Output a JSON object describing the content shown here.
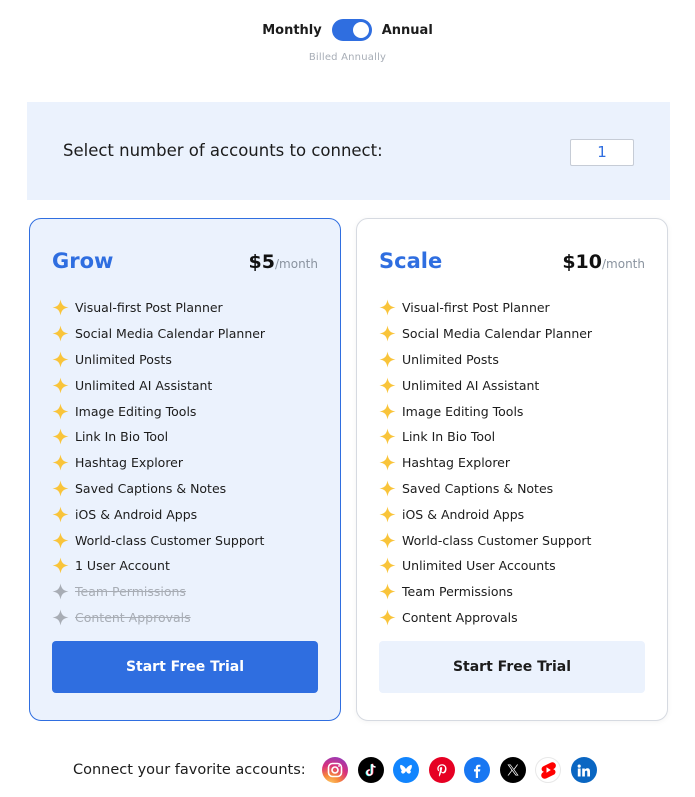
{
  "billing": {
    "monthly_label": "Monthly",
    "annual_label": "Annual",
    "toggle_state": "annual",
    "note": "Billed Annually"
  },
  "accounts": {
    "prompt": "Select number of accounts to connect:",
    "count": "1"
  },
  "colors": {
    "accent": "#2f6ee0",
    "panel": "#ebf2fd",
    "star": "#f9c43a",
    "star_disabled": "#a8adb5"
  },
  "plans": [
    {
      "name": "Grow",
      "price": "$5",
      "period": "/month",
      "cta": "Start Free Trial",
      "features": [
        {
          "text": "Visual-first Post Planner",
          "included": true
        },
        {
          "text": "Social Media Calendar Planner",
          "included": true
        },
        {
          "text": "Unlimited Posts",
          "included": true
        },
        {
          "text": "Unlimited AI Assistant",
          "included": true
        },
        {
          "text": "Image Editing Tools",
          "included": true
        },
        {
          "text": "Link In Bio Tool",
          "included": true
        },
        {
          "text": "Hashtag Explorer",
          "included": true
        },
        {
          "text": "Saved Captions & Notes",
          "included": true
        },
        {
          "text": "iOS & Android Apps",
          "included": true
        },
        {
          "text": "World-class Customer Support",
          "included": true
        },
        {
          "text": "1 User Account",
          "included": true
        },
        {
          "text": "Team Permissions",
          "included": false
        },
        {
          "text": "Content Approvals",
          "included": false
        }
      ]
    },
    {
      "name": "Scale",
      "price": "$10",
      "period": "/month",
      "cta": "Start Free Trial",
      "features": [
        {
          "text": "Visual-first Post Planner",
          "included": true
        },
        {
          "text": "Social Media Calendar Planner",
          "included": true
        },
        {
          "text": "Unlimited Posts",
          "included": true
        },
        {
          "text": "Unlimited AI Assistant",
          "included": true
        },
        {
          "text": "Image Editing Tools",
          "included": true
        },
        {
          "text": "Link In Bio Tool",
          "included": true
        },
        {
          "text": "Hashtag Explorer",
          "included": true
        },
        {
          "text": "Saved Captions & Notes",
          "included": true
        },
        {
          "text": "iOS & Android Apps",
          "included": true
        },
        {
          "text": "World-class Customer Support",
          "included": true
        },
        {
          "text": "Unlimited User Accounts",
          "included": true
        },
        {
          "text": "Team Permissions",
          "included": true
        },
        {
          "text": "Content Approvals",
          "included": true
        }
      ]
    }
  ],
  "social": {
    "label": "Connect your favorite accounts:",
    "networks": [
      "instagram-icon",
      "tiktok-icon",
      "bluesky-icon",
      "pinterest-icon",
      "facebook-icon",
      "x-icon",
      "youtube-shorts-icon",
      "linkedin-icon"
    ]
  }
}
